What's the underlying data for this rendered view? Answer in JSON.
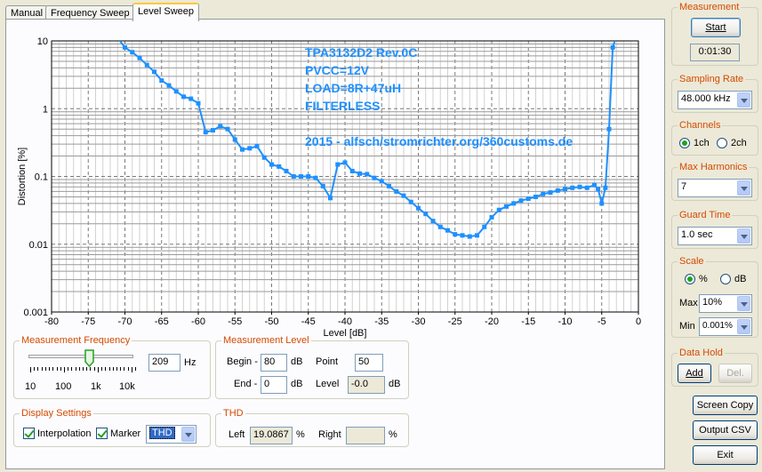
{
  "tabs": [
    {
      "label": "Manual"
    },
    {
      "label": "Frequency Sweep"
    },
    {
      "label": "Level Sweep"
    }
  ],
  "chart_data": {
    "type": "line",
    "ylabel": "Distortion [%]",
    "xlabel": "Level [dB]",
    "xlim": [
      -80,
      0
    ],
    "ylim": [
      0.001,
      10
    ],
    "yscale": "log",
    "grid": true,
    "x_ticks": [
      "-80",
      "-75",
      "-70",
      "-65",
      "-60",
      "-55",
      "-50",
      "-45",
      "-40",
      "-35",
      "-30",
      "-25",
      "-20",
      "-15",
      "-10",
      "-5",
      "0"
    ],
    "y_ticks": [
      "10",
      "1",
      "0.1",
      "0.01",
      "0.001"
    ],
    "annotation": [
      "TPA3132D2 Rev.0C",
      "PVCC=12V",
      "LOAD=8R+47uH",
      "FILTERLESS",
      "",
      "2015 - alfsch/stromrichter.org/360customs.de"
    ],
    "series": [
      {
        "color": "#1e90ff",
        "x": [
          -71,
          -70,
          -69,
          -68,
          -67,
          -66,
          -65,
          -64,
          -63,
          -62,
          -61,
          -60,
          -59,
          -58,
          -57,
          -56,
          -55,
          -54,
          -53,
          -52,
          -51,
          -50,
          -49,
          -48,
          -47,
          -46,
          -45,
          -44,
          -43,
          -42,
          -41,
          -40,
          -39,
          -38,
          -37,
          -36,
          -35,
          -34,
          -33,
          -32,
          -31,
          -30,
          -29,
          -28,
          -27,
          -26,
          -25,
          -24,
          -23,
          -22,
          -21,
          -20,
          -19,
          -18,
          -17,
          -16,
          -15,
          -14,
          -13,
          -12,
          -11,
          -10,
          -9,
          -8,
          -7,
          -6,
          -5.5,
          -5,
          -4.5,
          -4,
          -3.5,
          -3
        ],
        "y": [
          11,
          8.0,
          6.8,
          5.6,
          4.4,
          3.5,
          2.6,
          2.2,
          1.8,
          1.5,
          1.4,
          1.2,
          0.45,
          0.48,
          0.55,
          0.5,
          0.35,
          0.25,
          0.26,
          0.28,
          0.19,
          0.15,
          0.14,
          0.12,
          0.1,
          0.1,
          0.1,
          0.095,
          0.072,
          0.048,
          0.15,
          0.16,
          0.12,
          0.11,
          0.108,
          0.095,
          0.085,
          0.072,
          0.06,
          0.052,
          0.042,
          0.034,
          0.028,
          0.022,
          0.018,
          0.016,
          0.014,
          0.0135,
          0.013,
          0.0135,
          0.018,
          0.025,
          0.032,
          0.036,
          0.04,
          0.044,
          0.047,
          0.05,
          0.055,
          0.058,
          0.062,
          0.065,
          0.068,
          0.07,
          0.068,
          0.075,
          0.065,
          0.04,
          0.068,
          0.5,
          8.0,
          12
        ]
      }
    ]
  },
  "measurement_frequency": {
    "title": "Measurement Frequency",
    "slider_labels": [
      "10",
      "100",
      "1k",
      "10k"
    ],
    "slider_value": 0.58,
    "value": "209",
    "unit": "Hz"
  },
  "measurement_level": {
    "title": "Measurement Level",
    "begin_label": "Begin -",
    "begin_value": "80",
    "begin_unit": "dB",
    "end_label": "End -",
    "end_value": "0",
    "end_unit": "dB",
    "point_label": "Point",
    "point_value": "50",
    "level_label": "Level",
    "level_value": "-0.0",
    "level_unit": "dB"
  },
  "display_settings": {
    "title": "Display Settings",
    "interpolation_label": "Interpolation",
    "marker_label": "Marker",
    "mode_value": "THD"
  },
  "thd": {
    "title": "THD",
    "left_label": "Left",
    "left_value": "19.0867",
    "left_unit": "%",
    "right_label": "Right",
    "right_value": "",
    "right_unit": "%"
  },
  "right_panel": {
    "measurement": {
      "title": "Measurement",
      "start_label": "Start",
      "elapsed": "0:01:30"
    },
    "sampling_rate": {
      "title": "Sampling Rate",
      "value": "48.000 kHz"
    },
    "channels": {
      "title": "Channels",
      "opt1": "1ch",
      "opt2": "2ch"
    },
    "max_harmonics": {
      "title": "Max Harmonics",
      "value": "7"
    },
    "guard_time": {
      "title": "Guard Time",
      "value": "1.0 sec"
    },
    "scale": {
      "title": "Scale",
      "opt1": "%",
      "opt2": "dB",
      "max_label": "Max",
      "max_value": "10%",
      "min_label": "Min",
      "min_value": "0.001%"
    },
    "data_hold": {
      "title": "Data Hold",
      "add_label": "Add",
      "del_label": "Del."
    },
    "screen_copy_label": "Screen Copy",
    "output_csv_label": "Output CSV",
    "exit_label": "Exit"
  }
}
